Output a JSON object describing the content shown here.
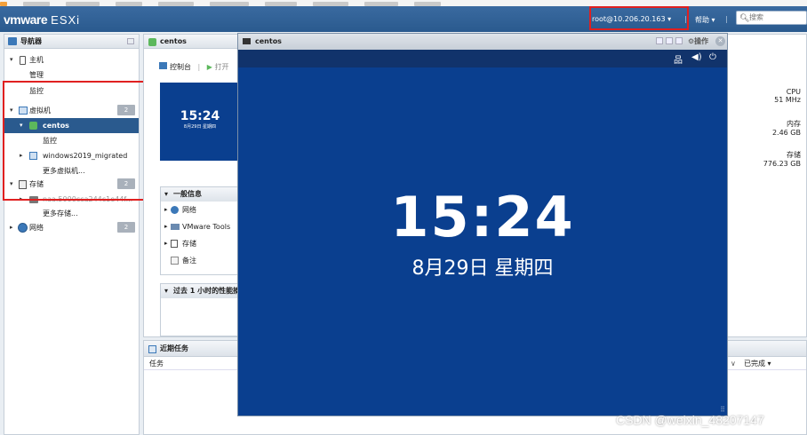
{
  "header": {
    "logo_vm": "vmware",
    "logo_product": "ESXi",
    "user": "root@10.206.20.163 ▾",
    "separator": "|",
    "help": "帮助 ▾",
    "search_placeholder": "搜索"
  },
  "navigator": {
    "title": "导航器",
    "items": [
      {
        "label": "主机"
      },
      {
        "label": "管理"
      },
      {
        "label": "监控"
      },
      {
        "label": "虚拟机",
        "badge": "2"
      },
      {
        "label": "centos"
      },
      {
        "label": "监控"
      },
      {
        "label": "windows2019_migrated"
      },
      {
        "label": "更多虚拟机..."
      },
      {
        "label": "存储",
        "badge": "2"
      },
      {
        "label": "naa.5000cca244c1e44f..."
      },
      {
        "label": "更多存储..."
      },
      {
        "label": "网络",
        "badge": "2"
      }
    ]
  },
  "vm_panel": {
    "tab": "centos",
    "toolbar": {
      "console": "控制台",
      "sep": "|",
      "power": "打开"
    },
    "thumb_time": "15:24",
    "thumb_date": "8月29日 星期四",
    "resources": [
      {
        "label": "CPU",
        "value": "51 MHz"
      },
      {
        "label": "内存",
        "value": "2.46 GB"
      },
      {
        "label": "存储",
        "value": "776.23 GB"
      }
    ],
    "general_info": {
      "title": "一般信息",
      "rows": [
        "网络",
        "VMware Tools",
        "存储",
        "备注"
      ]
    },
    "perf": {
      "title": "过去 1 小时的性能摘要"
    }
  },
  "tasks": {
    "title": "近期任务",
    "col_task": "任务",
    "col_completed": "已完成 ▾"
  },
  "console": {
    "title": "centos",
    "actions": "操作",
    "time": "15:24",
    "date": "8月29日 星期四",
    "icons": [
      "network-icon",
      "volume-icon",
      "power-icon"
    ]
  },
  "watermark": "CSDN @weixin_48207147",
  "colors": {
    "header_blue": "#2a5a8e",
    "console_blue": "#0a3f8f",
    "highlight_red": "#e02020"
  }
}
